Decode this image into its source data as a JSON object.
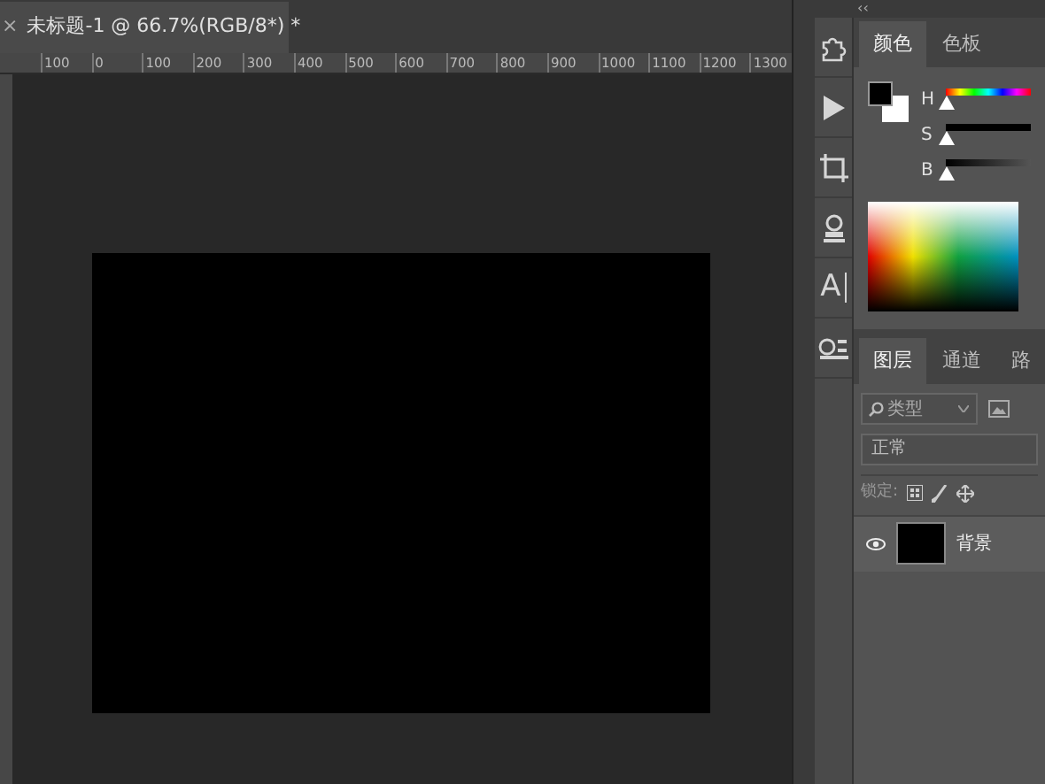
{
  "document_tab": {
    "close": "×",
    "title": "未标题-1 @ 66.7%(RGB/8*) *"
  },
  "ruler": {
    "labels": [
      "100",
      "0",
      "100",
      "200",
      "300",
      "400",
      "500",
      "600",
      "700",
      "800",
      "900",
      "1000",
      "1100",
      "1200",
      "1300"
    ]
  },
  "panel_collapse": "‹‹",
  "tools": [
    {
      "kind": "puzzle"
    },
    {
      "kind": "play"
    },
    {
      "kind": "crop"
    },
    {
      "kind": "stamp"
    },
    {
      "kind": "text",
      "label": "A"
    },
    {
      "kind": "paragraph"
    }
  ],
  "color_panel": {
    "tabs": [
      {
        "label": "颜色",
        "selected": true
      },
      {
        "label": "色板",
        "selected": false
      }
    ],
    "sliders": [
      {
        "label": "H",
        "kind": "hue",
        "level": 0
      },
      {
        "label": "S",
        "kind": "saturation",
        "level": 0
      },
      {
        "label": "B",
        "kind": "brightness",
        "level": 0
      }
    ]
  },
  "layers_panel": {
    "tabs": [
      {
        "label": "图层",
        "selected": true
      },
      {
        "label": "通道",
        "selected": false
      },
      {
        "label": "路",
        "selected": false
      }
    ],
    "filter": {
      "placeholder": "类型"
    },
    "blend_mode": "正常",
    "lock_label": "锁定:",
    "layers": [
      {
        "name": "背景",
        "visible": true
      }
    ]
  }
}
